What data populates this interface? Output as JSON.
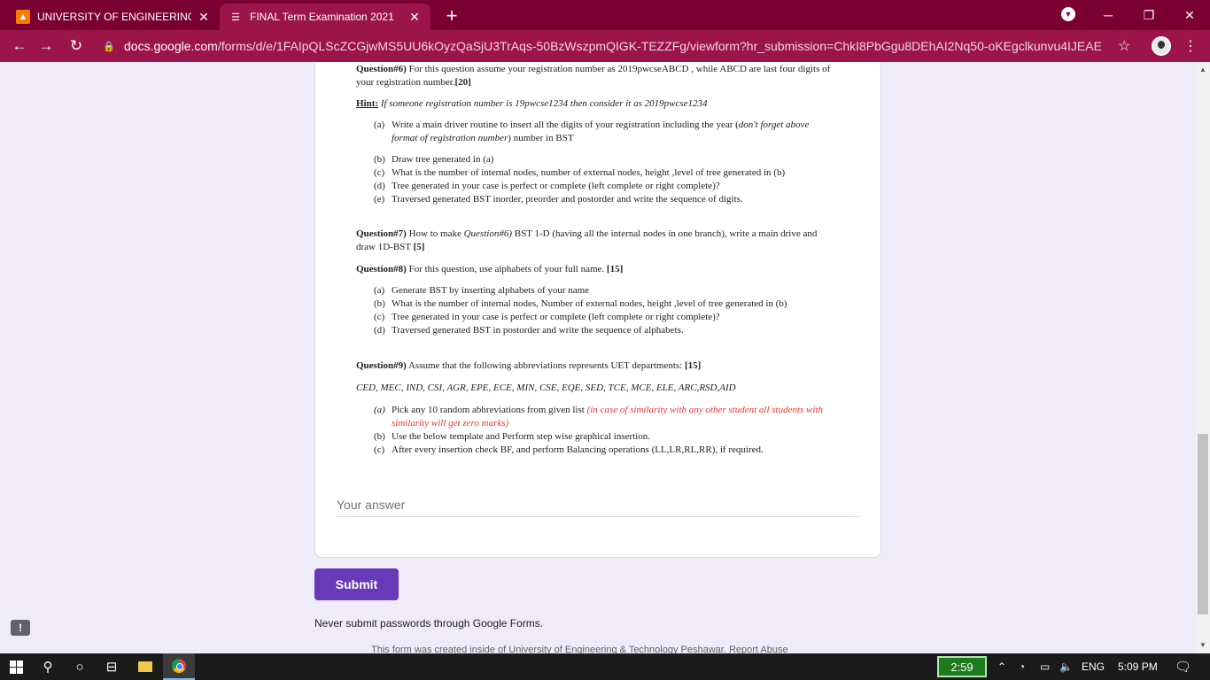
{
  "browser": {
    "tabs": [
      {
        "title": "UNIVERSITY OF ENGINEERING &",
        "close": "✕"
      },
      {
        "title": "FINAL Term Examination 2021",
        "close": "✕"
      }
    ],
    "new_tab": "+",
    "url_host": "docs.google.com",
    "url_path": "/forms/d/e/1FAIpQLScZCGjwMS5UU6kOyzQaSjU3TrAqs-50BzWszpmQIGK-TEZZFg/viewform?hr_submission=ChkI8PbGgu8DEhAI2Nq50-oKEgclkunvu4IJEAE",
    "window_controls": {
      "minimize": "─",
      "restore": "❐",
      "close": "✕"
    }
  },
  "doc": {
    "q6": {
      "head": "Question#6)",
      "text": " For this question assume your registration number as 2019pwcseABCD , while ABCD are last four digits of your registration number.",
      "marks": "[20]",
      "hint_label": "Hint:",
      "hint_text": " If someone registration number is 19pwcse1234 then consider it as 2019pwcse1234",
      "items": [
        {
          "label": "(a)",
          "text_pre": "Write a main driver routine to insert all the digits of your registration including the year (",
          "text_italic": "don't forget above format of registration number",
          "text_post": ") number in BST"
        },
        {
          "label": "(b)",
          "text": "Draw tree generated in (a)"
        },
        {
          "label": "(c)",
          "text": "What is the number of internal nodes, number of external nodes, height ,level  of tree generated in (b)"
        },
        {
          "label": "(d)",
          "text": "Tree generated in your case is perfect or complete (left complete or right complete)?"
        },
        {
          "label": "(e)",
          "text": "Traversed generated BST inorder, preorder and postorder and write the sequence of digits."
        }
      ]
    },
    "q7": {
      "head": "Question#7)",
      "text_pre": " How to make ",
      "text_italic": "Question#6)",
      "text_post": " BST 1-D (having all the internal nodes in one branch), write a main drive and draw 1D-BST ",
      "marks": "[5]"
    },
    "q8": {
      "head": "Question#8)",
      "text": " For this question, use alphabets of your full name. ",
      "marks": "[15]",
      "items": [
        {
          "label": "(a)",
          "text": "Generate BST by inserting alphabets of your name"
        },
        {
          "label": "(b)",
          "text": "What is the number of internal nodes, Number of external nodes, height ,level  of tree generated in (b)"
        },
        {
          "label": "(c)",
          "text": "Tree generated in your case is perfect or complete (left complete or right complete)?"
        },
        {
          "label": "(d)",
          "text": "Traversed generated BST in postorder and write the sequence of alphabets."
        }
      ]
    },
    "q9": {
      "head": "Question#9)",
      "text": " Assume that the following abbreviations represents UET departments: ",
      "marks": "[15]",
      "departments": "CED, MEC, IND, CSI, AGR, EPE, ECE, MIN, CSE, EQE, SED, TCE, MCE, ELE, ARC,RSD,AID",
      "items": [
        {
          "label": "(a)",
          "text": "Pick any 10 random abbreviations from given list ",
          "red": "(in case of similarity with any other student all students with similarity will get zero marks)"
        },
        {
          "label": "(b)",
          "text": "Use the below template and  Perform step wise graphical insertion."
        },
        {
          "label": "(c)",
          "text": "After every insertion check BF, and perform Balancing operations (LL,LR,RL,RR), if required."
        }
      ]
    }
  },
  "form": {
    "answer_placeholder": "Your answer",
    "submit_label": "Submit",
    "never_submit": "Never submit passwords through Google Forms.",
    "created_by": "This form was created inside of University of Engineering & Technology Peshawar. Report Abuse"
  },
  "taskbar": {
    "timer": "2:59",
    "language": "ENG",
    "time": "5:09 PM"
  },
  "colors": {
    "chrome_frame": "#7b0032",
    "chrome_toolbar": "#9b1548",
    "form_background": "#f0ebf8",
    "submit": "#673ab7",
    "red_note": "#e53935"
  }
}
